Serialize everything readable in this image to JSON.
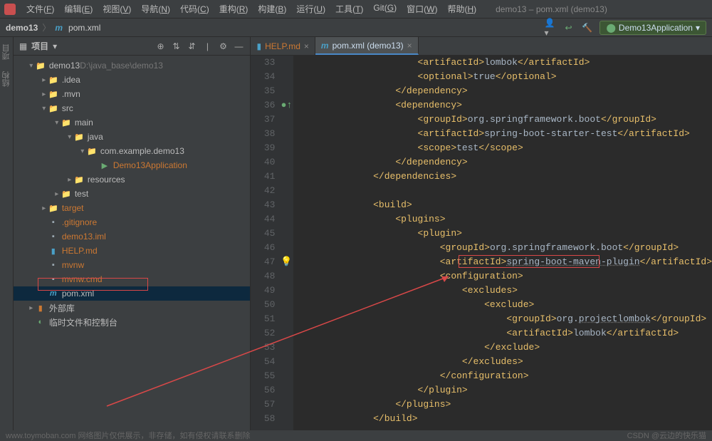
{
  "menubar": {
    "items": [
      {
        "label": "文件(F)",
        "key": "F"
      },
      {
        "label": "编辑(E)",
        "key": "E"
      },
      {
        "label": "视图(V)",
        "key": "V"
      },
      {
        "label": "导航(N)",
        "key": "N"
      },
      {
        "label": "代码(C)",
        "key": "C"
      },
      {
        "label": "重构(R)",
        "key": "R"
      },
      {
        "label": "构建(B)",
        "key": "B"
      },
      {
        "label": "运行(U)",
        "key": "U"
      },
      {
        "label": "工具(T)",
        "key": "T"
      },
      {
        "label": "Git(G)",
        "key": "G"
      },
      {
        "label": "窗口(W)",
        "key": "W"
      },
      {
        "label": "帮助(H)",
        "key": "H"
      }
    ],
    "title": "demo13 – pom.xml (demo13)"
  },
  "breadcrumb": {
    "project": "demo13",
    "file": "pom.xml"
  },
  "runconfig": {
    "label": "Demo13Application"
  },
  "sidebar": {
    "title": "项目",
    "tree": [
      {
        "indent": 0,
        "exp": "open",
        "icon": "folder-blue",
        "label": "demo13",
        "suffix": "D:\\java_base\\demo13"
      },
      {
        "indent": 1,
        "exp": "closed",
        "icon": "folder",
        "label": ".idea"
      },
      {
        "indent": 1,
        "exp": "closed",
        "icon": "folder",
        "label": ".mvn"
      },
      {
        "indent": 1,
        "exp": "open",
        "icon": "folder-blue",
        "label": "src"
      },
      {
        "indent": 2,
        "exp": "open",
        "icon": "folder-blue",
        "label": "main"
      },
      {
        "indent": 3,
        "exp": "open",
        "icon": "folder-blue",
        "label": "java"
      },
      {
        "indent": 4,
        "exp": "open",
        "icon": "folder",
        "label": "com.example.demo13"
      },
      {
        "indent": 5,
        "exp": "none",
        "icon": "kt",
        "label": "Demo13Application",
        "orange": true
      },
      {
        "indent": 3,
        "exp": "closed",
        "icon": "folder",
        "label": "resources"
      },
      {
        "indent": 2,
        "exp": "closed",
        "icon": "folder",
        "label": "test"
      },
      {
        "indent": 1,
        "exp": "closed",
        "icon": "folder-orange",
        "label": "target",
        "orange": true
      },
      {
        "indent": 1,
        "exp": "none",
        "icon": "file",
        "label": ".gitignore",
        "orange": true
      },
      {
        "indent": 1,
        "exp": "none",
        "icon": "file",
        "label": "demo13.iml",
        "orange": true
      },
      {
        "indent": 1,
        "exp": "none",
        "icon": "md",
        "label": "HELP.md",
        "orange": true
      },
      {
        "indent": 1,
        "exp": "none",
        "icon": "file",
        "label": "mvnw",
        "orange": true
      },
      {
        "indent": 1,
        "exp": "none",
        "icon": "file",
        "label": "mvnw.cmd",
        "orange": true
      },
      {
        "indent": 1,
        "exp": "none",
        "icon": "m",
        "label": "pom.xml",
        "selected": true,
        "boxed": true
      },
      {
        "indent": 0,
        "exp": "closed",
        "icon": "lib",
        "label": "外部库"
      },
      {
        "indent": 0,
        "exp": "none",
        "icon": "scratch",
        "label": "临时文件和控制台"
      }
    ]
  },
  "tabs": [
    {
      "icon": "md",
      "label": "HELP.md",
      "active": false
    },
    {
      "icon": "m",
      "label": "pom.xml (demo13)",
      "active": true
    }
  ],
  "code": {
    "startLine": 33,
    "lines": [
      {
        "n": 33,
        "ind": 5,
        "html": "<span class='tag'>&lt;artifactId&gt;</span>lombok<span class='tag'>&lt;/artifactId&gt;</span>"
      },
      {
        "n": 34,
        "ind": 5,
        "html": "<span class='tag'>&lt;optional&gt;</span>true<span class='tag'>&lt;/optional&gt;</span>"
      },
      {
        "n": 35,
        "ind": 4,
        "html": "<span class='tag'>&lt;/dependency&gt;</span>"
      },
      {
        "n": 36,
        "ind": 4,
        "mark": "green",
        "html": "<span class='tag'>&lt;dependency&gt;</span>"
      },
      {
        "n": 37,
        "ind": 5,
        "html": "<span class='tag'>&lt;groupId&gt;</span>org.springframework.boot<span class='tag'>&lt;/groupId&gt;</span>"
      },
      {
        "n": 38,
        "ind": 5,
        "html": "<span class='tag'>&lt;artifactId&gt;</span>spring-boot-starter-test<span class='tag'>&lt;/artifactId&gt;</span>"
      },
      {
        "n": 39,
        "ind": 5,
        "html": "<span class='tag'>&lt;scope&gt;</span>test<span class='tag'>&lt;/scope&gt;</span>"
      },
      {
        "n": 40,
        "ind": 4,
        "html": "<span class='tag'>&lt;/dependency&gt;</span>"
      },
      {
        "n": 41,
        "ind": 3,
        "html": "<span class='tag'>&lt;/dependencies&gt;</span>"
      },
      {
        "n": 42,
        "ind": 0,
        "html": ""
      },
      {
        "n": 43,
        "ind": 3,
        "html": "<span class='tag'>&lt;build&gt;</span>"
      },
      {
        "n": 44,
        "ind": 4,
        "html": "<span class='tag'>&lt;plugins&gt;</span>"
      },
      {
        "n": 45,
        "ind": 5,
        "html": "<span class='tag'>&lt;plugin&gt;</span>"
      },
      {
        "n": 46,
        "ind": 6,
        "html": "<span class='tag'>&lt;groupId&gt;</span>org.springframework.boot<span class='tag'>&lt;/groupId&gt;</span>"
      },
      {
        "n": 47,
        "ind": 6,
        "mark": "bulb",
        "html": "<span class='tag'>&lt;artifactId&gt;</span><span class='hl'>spring-boot-maven-plugin</span><span class='tag'>&lt;/artifactId&gt;</span>",
        "highlight": true
      },
      {
        "n": 48,
        "ind": 6,
        "html": "<span class='tag'>&lt;configuration&gt;</span>"
      },
      {
        "n": 49,
        "ind": 7,
        "html": "<span class='tag'>&lt;excludes&gt;</span>"
      },
      {
        "n": 50,
        "ind": 8,
        "html": "<span class='tag'>&lt;exclude&gt;</span>"
      },
      {
        "n": 51,
        "ind": 9,
        "html": "<span class='tag'>&lt;groupId&gt;</span>org.<span class='hl'>projectlombok</span><span class='tag'>&lt;/groupId&gt;</span>"
      },
      {
        "n": 52,
        "ind": 9,
        "html": "<span class='tag'>&lt;artifactId&gt;</span>lombok<span class='tag'>&lt;/artifactId&gt;</span>"
      },
      {
        "n": 53,
        "ind": 8,
        "html": "<span class='tag'>&lt;/exclude&gt;</span>"
      },
      {
        "n": 54,
        "ind": 7,
        "html": "<span class='tag'>&lt;/excludes&gt;</span>"
      },
      {
        "n": 55,
        "ind": 6,
        "html": "<span class='tag'>&lt;/configuration&gt;</span>"
      },
      {
        "n": 56,
        "ind": 5,
        "html": "<span class='tag'>&lt;/plugin&gt;</span>"
      },
      {
        "n": 57,
        "ind": 4,
        "html": "<span class='tag'>&lt;/plugins&gt;</span>"
      },
      {
        "n": 58,
        "ind": 3,
        "html": "<span class='tag'>&lt;/build&gt;</span>"
      }
    ]
  },
  "footer": {
    "left": "www.toymoban.com 网络图片仅供展示，非存储，如有侵权请联系删除",
    "right": "CSDN @云边的快乐猫"
  }
}
